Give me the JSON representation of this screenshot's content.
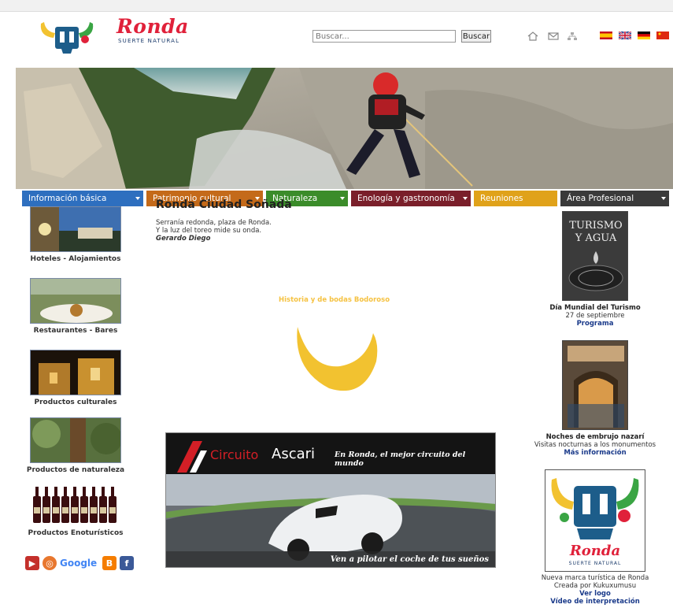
{
  "header": {
    "brand_name": "Ronda",
    "brand_tagline": "SUERTE NATURAL",
    "search_placeholder": "Buscar...",
    "search_button": "Buscar"
  },
  "nav": {
    "items": [
      {
        "label": "Información básica",
        "color": "#2e6fbf"
      },
      {
        "label": "Patrimonio cultural",
        "color": "#c46a1a"
      },
      {
        "label": "Naturaleza",
        "color": "#3b8c2a"
      },
      {
        "label": "Enología y gastronomía",
        "color": "#7a1f2a"
      },
      {
        "label": "Reuniones",
        "color": "#e0a21a"
      },
      {
        "label": "Área Profesional",
        "color": "#3a3a3a"
      }
    ]
  },
  "left": {
    "categories": [
      {
        "label": "Hoteles - Alojamientos"
      },
      {
        "label": "Restaurantes - Bares"
      },
      {
        "label": "Productos culturales"
      },
      {
        "label": "Productos de naturaleza"
      },
      {
        "label": "Productos Enoturísticos"
      }
    ]
  },
  "main": {
    "title": "Ronda Ciudad Soñada",
    "poem_line1": "Serranía redonda, plaza de Ronda.",
    "poem_line2": "Y la luz del toreo mide su onda.",
    "poem_author": "Gerardo Diego",
    "yellow_caption": "Historia y de bodas Bodoroso",
    "ad_brand_a": "Circuito",
    "ad_brand_b": "Ascari",
    "ad_tagline": "En Ronda, el mejor circuito del mundo",
    "ad_bottom": "Ven a pilotar el coche de tus sueños"
  },
  "right": {
    "poster1_text_a": "TURISMO",
    "poster1_text_b": "Y AGUA",
    "event1_title": "Día Mundial del Turismo",
    "event1_date": "27 de septiembre",
    "event1_link": "Programa",
    "event2_title": "Noches de embrujo nazarí",
    "event2_desc": "Visitas nocturnas a los monumentos",
    "event2_link": "Más información",
    "brand_card_name": "Ronda",
    "brand_card_tagline": "SUERTE NATURAL",
    "brand_desc1": "Nueva marca turística de Ronda",
    "brand_desc2": "Creada por Kukuxumusu",
    "brand_link1": "Ver logo",
    "brand_link2": "Vídeo de interpretación"
  },
  "social": {
    "google_label": "Google"
  }
}
